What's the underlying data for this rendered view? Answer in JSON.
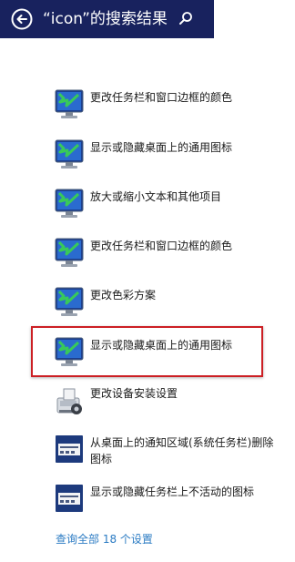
{
  "header": {
    "title": "“icon”的搜索结果",
    "bg_color": "#18225e"
  },
  "results": [
    {
      "label": "更改任务栏和窗口边框的颜色",
      "icon": "display-settings-icon"
    },
    {
      "label": "显示或隐藏桌面上的通用图标",
      "icon": "display-settings-icon"
    },
    {
      "label": "放大或缩小文本和其他项目",
      "icon": "display-settings-icon"
    },
    {
      "label": "更改任务栏和窗口边框的颜色",
      "icon": "display-settings-icon"
    },
    {
      "label": "更改色彩方案",
      "icon": "display-settings-icon"
    },
    {
      "label": "显示或隐藏桌面上的通用图标",
      "icon": "display-settings-icon",
      "highlighted": true
    },
    {
      "label": "更改设备安装设置",
      "icon": "device-installation-icon"
    },
    {
      "label": "从桌面上的通知区域(系统任务栏)删除图标",
      "icon": "taskbar-icon"
    },
    {
      "label": "显示或隐藏任务栏上不活动的图标",
      "icon": "taskbar-icon"
    }
  ],
  "view_all": "查询全部 18 个设置",
  "colors": {
    "highlight": "#cc1f24",
    "link": "#2b7bc3"
  }
}
